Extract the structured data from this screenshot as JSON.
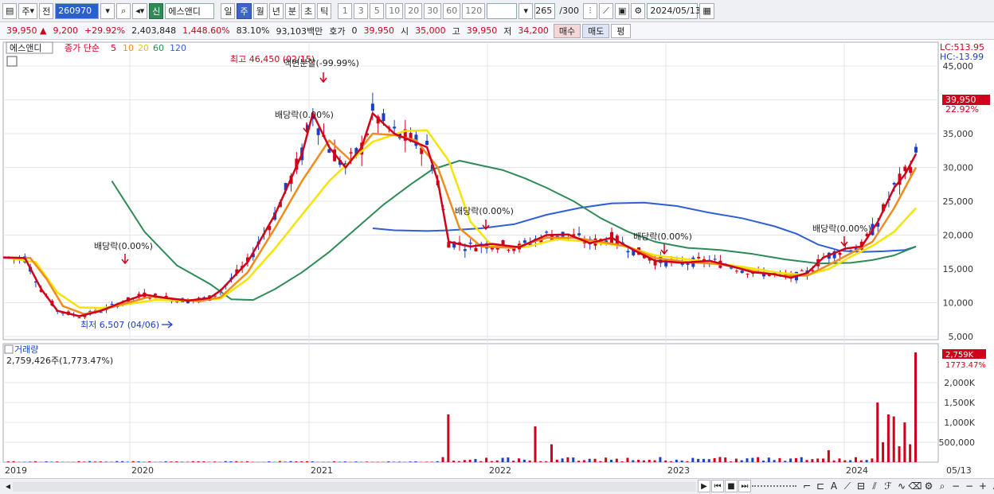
{
  "toolbar": {
    "period_label": "주",
    "prev_label": "전",
    "code": "260970",
    "badge_new": "신",
    "stock_name": "에스앤디",
    "tf_day": "일",
    "tf_week": "주",
    "tf_month": "월",
    "tf_year": "년",
    "tf_min": "분",
    "tf_sec": "초",
    "tf_tick": "틱",
    "intervals": [
      "1",
      "3",
      "5",
      "10",
      "20",
      "30",
      "60",
      "120"
    ],
    "count": "265",
    "max_count": "/300",
    "date": "2024/05/13"
  },
  "quote": {
    "price": "39,950",
    "change": "9,200",
    "change_pct": "+29.92%",
    "volume": "2,403,848",
    "vol_ratio": "1,448.60%",
    "turnover": "83.10%",
    "amount": "93,103백만",
    "ask_label": "호가",
    "ask_val": "0",
    "ask_price": "39,950",
    "open_label": "시",
    "open": "35,000",
    "high_label": "고",
    "high": "39,950",
    "low_label": "저",
    "low": "34,200",
    "buy": "매수",
    "sell": "매도",
    "flat": "평"
  },
  "chart_data": {
    "type": "line",
    "title": "에스앤디",
    "legend_prefix": "종가 단순",
    "legend": [
      "5",
      "10",
      "20",
      "60",
      "120"
    ],
    "legend_colors": [
      "#d0021b",
      "#f08c1e",
      "#f5e400",
      "#2e8b57",
      "#2f5fd8"
    ],
    "ylim": [
      5000,
      46450
    ],
    "y_ticks": [
      "45,000",
      "40,000",
      "35,000",
      "30,000",
      "25,000",
      "20,000",
      "15,000",
      "10,000",
      "5,000"
    ],
    "x_labels": [
      "2019",
      "2020",
      "2021",
      "2022",
      "2023",
      "2024",
      "05/13"
    ],
    "lc_label": "LC:513.95",
    "hc_label": "HC:-13.99",
    "current_price_tag": "39,950",
    "current_pct_tag": "22.92%",
    "high_annotation": "최고 46,450 (02/15)",
    "low_annotation": "최저 6,507 (04/06)",
    "split_annotation": "액면분할(-99.99%)",
    "dividend_labels": [
      "배당락(0.00%)",
      "배당락(0.00%)",
      "배당락(0.00%)",
      "배당락(0.00%)",
      "배당락(0.00%)"
    ],
    "ma5": [
      [
        0,
        16700
      ],
      [
        4,
        16600
      ],
      [
        7,
        12000
      ],
      [
        10,
        8800
      ],
      [
        14,
        8000
      ],
      [
        18,
        8800
      ],
      [
        22,
        10100
      ],
      [
        26,
        11200
      ],
      [
        30,
        10700
      ],
      [
        34,
        10300
      ],
      [
        38,
        10700
      ],
      [
        40,
        11800
      ],
      [
        45,
        16000
      ],
      [
        50,
        23000
      ],
      [
        55,
        32000
      ],
      [
        57,
        38000
      ],
      [
        60,
        33000
      ],
      [
        63,
        30000
      ],
      [
        66,
        33000
      ],
      [
        68,
        38000
      ],
      [
        72,
        35000
      ],
      [
        75,
        34000
      ],
      [
        78,
        33000
      ],
      [
        80,
        28000
      ],
      [
        82,
        19000
      ],
      [
        86,
        18300
      ],
      [
        90,
        18700
      ],
      [
        95,
        18200
      ],
      [
        100,
        20000
      ],
      [
        104,
        20100
      ],
      [
        108,
        18800
      ],
      [
        112,
        19600
      ],
      [
        116,
        17800
      ],
      [
        120,
        16200
      ],
      [
        125,
        15900
      ],
      [
        130,
        16200
      ],
      [
        134,
        15400
      ],
      [
        138,
        14500
      ],
      [
        142,
        14200
      ],
      [
        145,
        13700
      ],
      [
        148,
        14400
      ],
      [
        151,
        16700
      ],
      [
        155,
        18000
      ],
      [
        158,
        18300
      ],
      [
        161,
        22000
      ],
      [
        164,
        27000
      ],
      [
        166,
        29000
      ],
      [
        168,
        32000
      ]
    ],
    "ma10": [
      [
        0,
        16700
      ],
      [
        5,
        16600
      ],
      [
        8,
        13500
      ],
      [
        11,
        9500
      ],
      [
        15,
        8300
      ],
      [
        19,
        9100
      ],
      [
        23,
        10000
      ],
      [
        27,
        10900
      ],
      [
        31,
        10600
      ],
      [
        36,
        10200
      ],
      [
        40,
        10800
      ],
      [
        45,
        14500
      ],
      [
        50,
        21000
      ],
      [
        55,
        28000
      ],
      [
        60,
        34000
      ],
      [
        64,
        31000
      ],
      [
        68,
        35000
      ],
      [
        72,
        34800
      ],
      [
        76,
        34000
      ],
      [
        80,
        30000
      ],
      [
        84,
        21000
      ],
      [
        88,
        18300
      ],
      [
        94,
        18100
      ],
      [
        100,
        19600
      ],
      [
        105,
        19600
      ],
      [
        110,
        19000
      ],
      [
        115,
        18300
      ],
      [
        120,
        16600
      ],
      [
        126,
        16000
      ],
      [
        132,
        15700
      ],
      [
        138,
        14700
      ],
      [
        143,
        14000
      ],
      [
        148,
        14000
      ],
      [
        152,
        15600
      ],
      [
        156,
        17300
      ],
      [
        160,
        19000
      ],
      [
        164,
        24000
      ],
      [
        168,
        30000
      ]
    ],
    "ma20": [
      [
        0,
        16700
      ],
      [
        6,
        16000
      ],
      [
        10,
        11500
      ],
      [
        14,
        9300
      ],
      [
        18,
        9200
      ],
      [
        23,
        9800
      ],
      [
        28,
        10400
      ],
      [
        33,
        10300
      ],
      [
        40,
        10600
      ],
      [
        45,
        13500
      ],
      [
        50,
        18000
      ],
      [
        55,
        23000
      ],
      [
        60,
        28000
      ],
      [
        64,
        31000
      ],
      [
        68,
        33800
      ],
      [
        74,
        35400
      ],
      [
        78,
        35500
      ],
      [
        82,
        31000
      ],
      [
        86,
        22000
      ],
      [
        90,
        18400
      ],
      [
        96,
        18200
      ],
      [
        102,
        19400
      ],
      [
        108,
        19000
      ],
      [
        114,
        18400
      ],
      [
        120,
        17000
      ],
      [
        128,
        16200
      ],
      [
        136,
        15300
      ],
      [
        143,
        14400
      ],
      [
        148,
        14100
      ],
      [
        152,
        15000
      ],
      [
        156,
        16800
      ],
      [
        160,
        18400
      ],
      [
        164,
        20500
      ],
      [
        168,
        24000
      ]
    ],
    "ma60": [
      [
        20,
        28000
      ],
      [
        26,
        20500
      ],
      [
        32,
        15500
      ],
      [
        38,
        12800
      ],
      [
        42,
        10500
      ],
      [
        46,
        10400
      ],
      [
        50,
        12000
      ],
      [
        55,
        14500
      ],
      [
        60,
        17500
      ],
      [
        65,
        21000
      ],
      [
        70,
        24500
      ],
      [
        75,
        27500
      ],
      [
        79,
        29700
      ],
      [
        84,
        31000
      ],
      [
        88,
        30300
      ],
      [
        92,
        29600
      ],
      [
        96,
        28400
      ],
      [
        100,
        27000
      ],
      [
        105,
        25000
      ],
      [
        110,
        22500
      ],
      [
        115,
        20500
      ],
      [
        120,
        19000
      ],
      [
        126,
        18100
      ],
      [
        132,
        17800
      ],
      [
        138,
        17200
      ],
      [
        144,
        16400
      ],
      [
        150,
        15800
      ],
      [
        156,
        15900
      ],
      [
        160,
        16300
      ],
      [
        164,
        17000
      ],
      [
        168,
        18300
      ]
    ],
    "ma120": [
      [
        68,
        21000
      ],
      [
        72,
        20700
      ],
      [
        78,
        20600
      ],
      [
        82,
        20700
      ],
      [
        88,
        21000
      ],
      [
        94,
        21600
      ],
      [
        100,
        23000
      ],
      [
        106,
        24000
      ],
      [
        112,
        24700
      ],
      [
        118,
        24800
      ],
      [
        124,
        24300
      ],
      [
        130,
        23300
      ],
      [
        136,
        22500
      ],
      [
        142,
        21300
      ],
      [
        146,
        20200
      ],
      [
        150,
        18600
      ],
      [
        154,
        17700
      ],
      [
        158,
        17500
      ],
      [
        162,
        17600
      ],
      [
        166,
        17800
      ],
      [
        168,
        18300
      ]
    ],
    "volume_label": "거래량",
    "volume_value": "2,759,426주(1,773.47%)",
    "volume_tag": "2,759K",
    "volume_pct": "1773.47%",
    "volume_ticks": [
      "2,000K",
      "1,500K",
      "1,000K",
      "500,000"
    ],
    "volume_max": 2800000,
    "volume_spikes": [
      [
        82,
        1200000
      ],
      [
        98,
        900000
      ],
      [
        101,
        450000
      ],
      [
        152,
        300000
      ],
      [
        161,
        1500000
      ],
      [
        162,
        500000
      ],
      [
        163,
        1200000
      ],
      [
        164,
        1150000
      ],
      [
        165,
        400000
      ],
      [
        166,
        1000000
      ],
      [
        167,
        450000
      ],
      [
        168,
        2759426
      ]
    ]
  },
  "nav": {
    "controls": [
      "▶",
      "⏮",
      "■",
      "⏭"
    ]
  }
}
